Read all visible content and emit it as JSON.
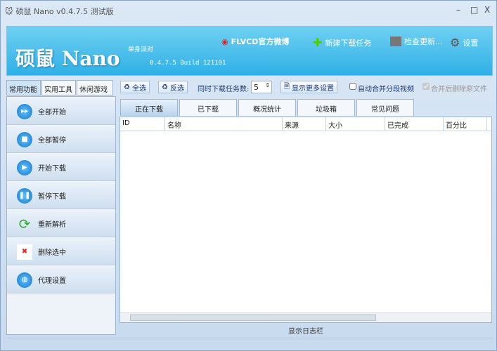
{
  "window": {
    "title": "硕鼠 Nano v0.4.7.5 测试版",
    "min": "–",
    "max": "□",
    "close": "X"
  },
  "banner": {
    "logo": "硕鼠 Nano",
    "tagline": "单身派对",
    "build": "0.4.7.5 Build 121101",
    "weibo": "FLVCD官方微博",
    "new_task": "新建下载任务",
    "check_update": "检查更新...",
    "settings": "设置"
  },
  "left_tabs": [
    "常用功能",
    "实用工具",
    "休闲游戏"
  ],
  "toolbar": {
    "select_all": "全选",
    "invert": "反选",
    "concurrent_label": "同时下载任务数:",
    "concurrent_value": "5",
    "more_settings": "显示更多设置",
    "auto_merge": "自动合并分段视频",
    "delete_after_merge": "合并后删除原文件"
  },
  "actions": [
    "全部开始",
    "全部暂停",
    "开始下载",
    "暂停下载",
    "重新解析",
    "删除选中",
    "代理设置"
  ],
  "tabs": [
    "正在下载",
    "已下载",
    "概况统计",
    "垃圾箱",
    "常见问题"
  ],
  "columns": [
    "ID",
    "名称",
    "来源",
    "大小",
    "已完成",
    "百分比"
  ],
  "log_label": "显示日志栏"
}
